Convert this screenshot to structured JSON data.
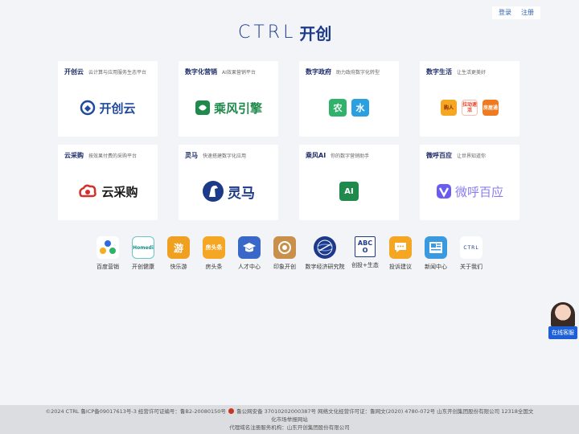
{
  "auth": {
    "login": "登录",
    "register": "注册"
  },
  "logo": {
    "en": "CTRL",
    "cn": "开创"
  },
  "cards": [
    {
      "title": "开创云",
      "subtitle": "云计算与应用服务生态平台",
      "brand": "开创云",
      "brand_color": "#1f4a9e"
    },
    {
      "title": "数字化营销",
      "subtitle": "AI效果营销平台",
      "brand": "乘风引擎",
      "brand_color": "#1f8a4c"
    },
    {
      "title": "数字政府",
      "subtitle": "助力政府数字化转型",
      "apps": [
        "农",
        "水"
      ]
    },
    {
      "title": "数字生活",
      "subtitle": "让生活更美好",
      "apps": [
        "购人",
        "拉动速活",
        "房屋通"
      ]
    },
    {
      "title": "云采购",
      "subtitle": "按效果付费的采购平台",
      "brand": "云采购",
      "brand_color": "#1a1a1a"
    },
    {
      "title": "灵马",
      "subtitle": "快速搭建数字化应用",
      "brand": "灵马",
      "brand_color": "#1d3a8a"
    },
    {
      "title": "乘风AI",
      "subtitle": "你的数字营销助手",
      "brand": "AI",
      "brand_color": "#1f8a4c"
    },
    {
      "title": "微呼百应",
      "subtitle": "让世界知道你",
      "brand": "微呼百应",
      "brand_color": "#8a7cf0"
    }
  ],
  "apps": [
    {
      "label": "百度营销",
      "glyph": "✱",
      "color": "#ffffff",
      "icon": "baidu-marketing-icon"
    },
    {
      "label": "开创健康",
      "glyph": "Homedi",
      "color": "#ffffff",
      "icon": "homedi-icon"
    },
    {
      "label": "快乐游",
      "glyph": "游",
      "color": "#f0a020",
      "icon": "kuaileyou-icon"
    },
    {
      "label": "房头条",
      "glyph": "房头条",
      "color": "#f5a623",
      "icon": "fangtoutiao-icon"
    },
    {
      "label": "人才中心",
      "glyph": "🎓",
      "color": "#3a68c8",
      "icon": "talent-center-icon"
    },
    {
      "label": "印象开创",
      "glyph": "◎",
      "color": "#c8904a",
      "icon": "yinxiang-icon"
    },
    {
      "label": "数字经济研究院",
      "glyph": "◉",
      "color": "#1d3a8a",
      "icon": "digital-economy-icon"
    },
    {
      "label": "创投+生态",
      "glyph": "ABCO",
      "color": "#ffffff",
      "icon": "venture-icon"
    },
    {
      "label": "投诉建议",
      "glyph": "…",
      "color": "#f5a623",
      "icon": "complaint-icon"
    },
    {
      "label": "新闻中心",
      "glyph": "▤",
      "color": "#3a9ae0",
      "icon": "news-icon"
    },
    {
      "label": "关于我们",
      "glyph": "CTRL",
      "color": "#ffffff",
      "icon": "about-icon"
    }
  ],
  "kefu": {
    "label": "在线客服"
  },
  "footer": {
    "line1a": "©2024  CTRL 鲁ICP备09017613号-3 经营许可证编号：鲁B2-20080150号",
    "line1b": "鲁公网安备 37010202000387号 网络文化经营许可证：鲁网文(2020) 4780-072号 山东开创集团股份有限公司 12318全国文",
    "line2": "化市场举报网站",
    "line3": "代理域名注册服务机构：山东开创集团股份有限公司"
  }
}
